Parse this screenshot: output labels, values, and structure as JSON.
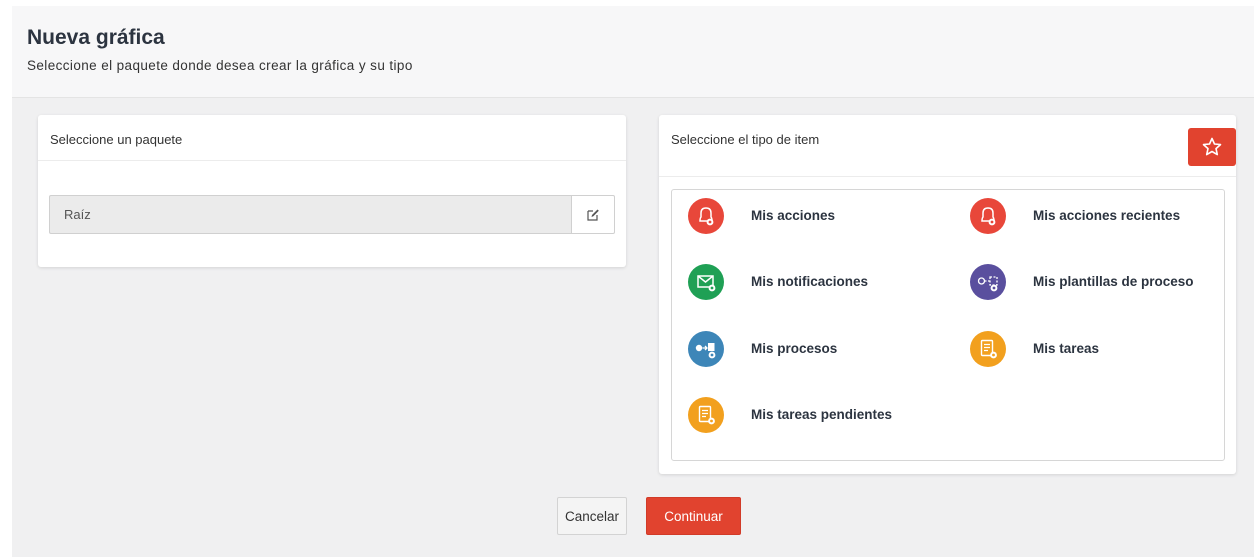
{
  "header": {
    "title": "Nueva gráfica",
    "subtitle": "Seleccione el paquete donde desea crear la gráfica y su tipo"
  },
  "package_panel": {
    "title": "Seleccione un paquete",
    "selected_package": "Raíz",
    "edit_icon": "edit-icon"
  },
  "type_panel": {
    "title": "Seleccione el tipo de item",
    "favorite_icon": "star-icon",
    "items": [
      {
        "label": "Mis acciones",
        "icon": "bell-icon",
        "color": "#e8473a"
      },
      {
        "label": "Mis acciones recientes",
        "icon": "bell-icon",
        "color": "#e8473a"
      },
      {
        "label": "Mis notificaciones",
        "icon": "envelope-icon",
        "color": "#1fa055"
      },
      {
        "label": "Mis plantillas de proceso",
        "icon": "process-template-icon",
        "color": "#5a4f9e"
      },
      {
        "label": "Mis procesos",
        "icon": "process-icon",
        "color": "#3d86b8"
      },
      {
        "label": "Mis tareas",
        "icon": "task-list-icon",
        "color": "#f2a01e"
      },
      {
        "label": "Mis tareas pendientes",
        "icon": "task-list-icon",
        "color": "#f2a01e"
      }
    ]
  },
  "footer": {
    "cancel_label": "Cancelar",
    "continue_label": "Continuar"
  },
  "colors": {
    "accent": "#e1432f"
  }
}
